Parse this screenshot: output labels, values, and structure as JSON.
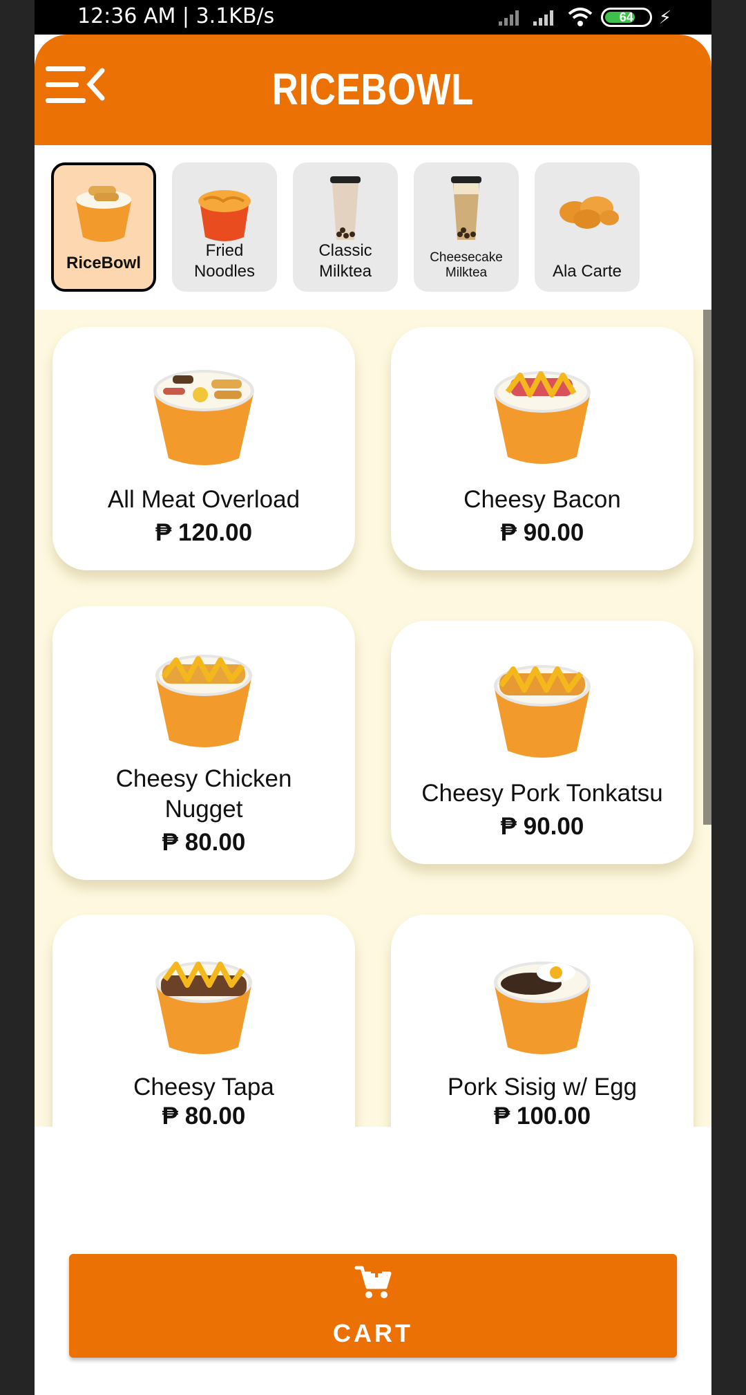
{
  "status": {
    "time": "12:36 AM | 3.1KB/s",
    "battery": "64"
  },
  "header": {
    "title": "RICEBOWL"
  },
  "categories": [
    {
      "label": "RiceBowl",
      "active": true
    },
    {
      "label": "Fried\nNoodles"
    },
    {
      "label": "Classic\nMilktea"
    },
    {
      "label": "Cheesecake\nMilktea"
    },
    {
      "label": "Ala Carte"
    }
  ],
  "items": [
    {
      "name": "All Meat Overload",
      "price": "₱ 120.00"
    },
    {
      "name": "Cheesy Bacon",
      "price": "₱ 90.00"
    },
    {
      "name": "Cheesy Chicken\nNugget",
      "price": "₱ 80.00"
    },
    {
      "name": "Cheesy Pork Tonkatsu",
      "price": "₱ 90.00"
    },
    {
      "name": "Cheesy Tapa",
      "price": "₱ 80.00"
    },
    {
      "name": "Pork Sisig w/ Egg",
      "price": "₱ 100.00"
    }
  ],
  "cart": {
    "label": "CART"
  },
  "colors": {
    "accent": "#ec7105",
    "active_tab": "#fdd7b0",
    "grid_bg": "#fdf8df"
  }
}
